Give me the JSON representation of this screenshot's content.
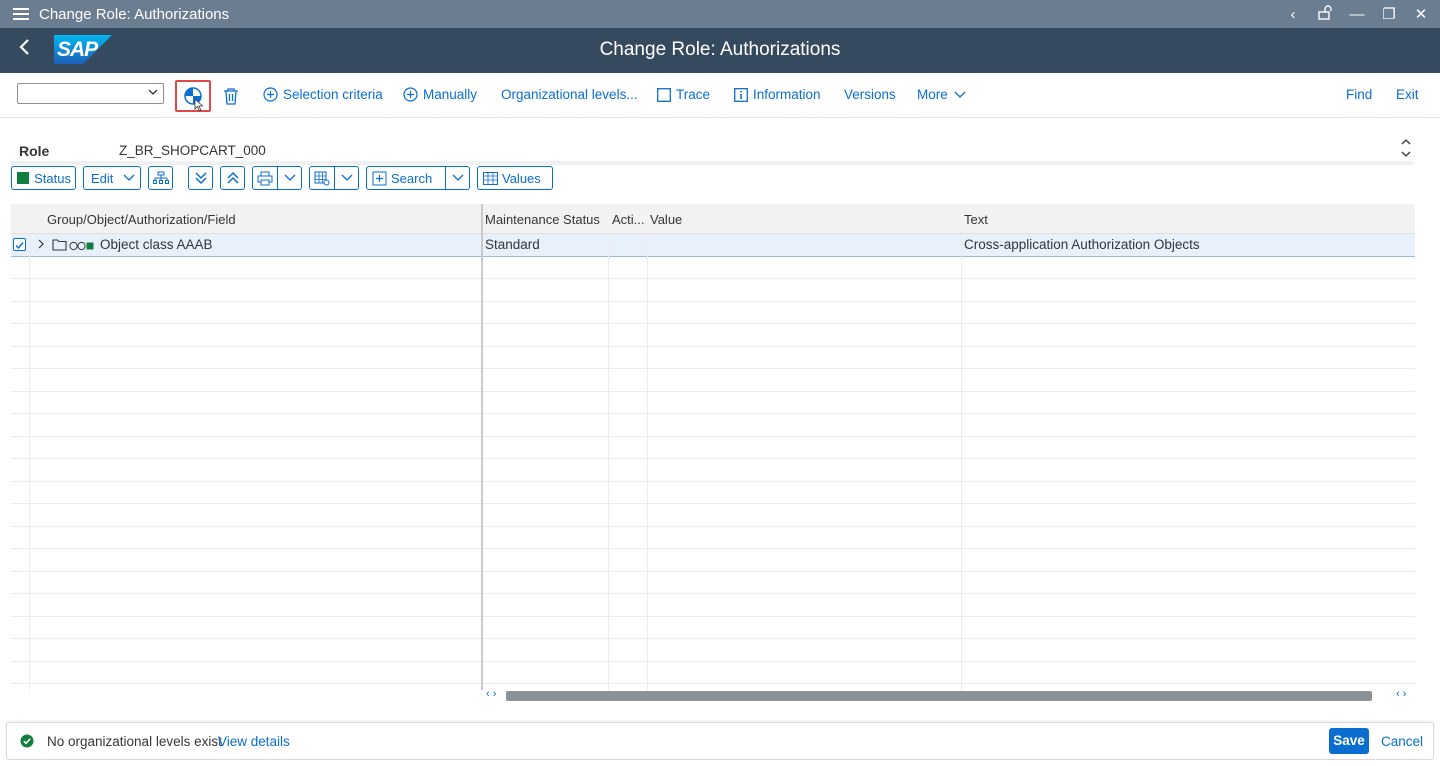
{
  "window": {
    "title": "Change Role: Authorizations",
    "controls": [
      "‹",
      "🔓",
      "—",
      "❐",
      "✕"
    ]
  },
  "shell": {
    "logo_text": "SAP",
    "page_title": "Change Role: Authorizations"
  },
  "toolbar": {
    "select_value": "",
    "selection_criteria": "Selection criteria",
    "manually": "Manually",
    "org_levels": "Organizational levels...",
    "trace": "Trace",
    "information": "Information",
    "versions": "Versions",
    "more": "More",
    "find": "Find",
    "exit": "Exit"
  },
  "role": {
    "label": "Role",
    "value": "Z_BR_SHOPCART_000",
    "dots": "....."
  },
  "tree_toolbar": {
    "status": "Status",
    "edit": "Edit",
    "search": "Search",
    "values": "Values"
  },
  "table": {
    "columns": [
      "Group/Object/Authorization/Field",
      "Maintenance Status",
      "Acti...",
      "Value",
      "Text"
    ],
    "rows": [
      {
        "name": "Object class AAAB",
        "maintenance_status": "Standard",
        "activity": "",
        "value": "",
        "text": "Cross-application Authorization Objects",
        "selected": true
      }
    ]
  },
  "footer": {
    "message": "No organizational levels exist",
    "details": "View details",
    "save": "Save",
    "cancel": "Cancel"
  },
  "colors": {
    "shell_bg": "#354a5f",
    "window_bar": "#6a7d91",
    "accent": "#0a6ed1",
    "status_green": "#107e3e",
    "highlight_red": "#e04a4a"
  }
}
